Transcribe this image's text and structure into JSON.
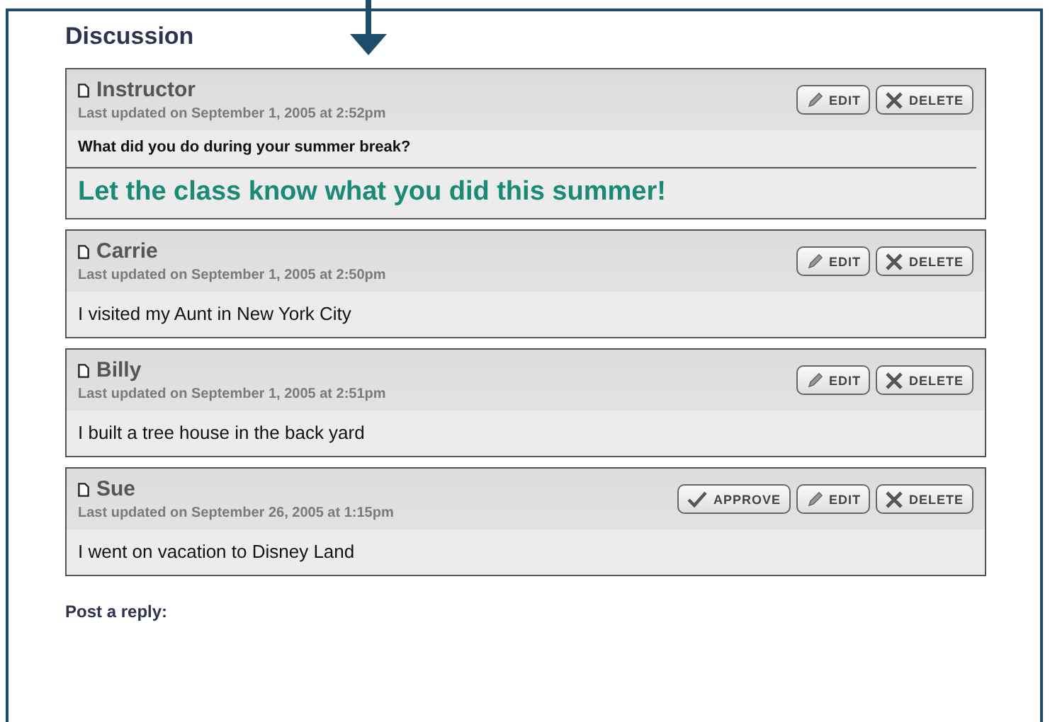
{
  "heading": "Discussion",
  "posts": [
    {
      "author": "Instructor",
      "updated": "Last updated on September 1, 2005 at 2:52pm",
      "actions": [
        {
          "kind": "edit",
          "label": "EDIT"
        },
        {
          "kind": "delete",
          "label": "DELETE"
        }
      ],
      "question": "What did you do during your summer break?",
      "prompt": "Let the class know what you did this summer!"
    },
    {
      "author": "Carrie",
      "updated": "Last updated on September 1, 2005 at 2:50pm",
      "actions": [
        {
          "kind": "edit",
          "label": "EDIT"
        },
        {
          "kind": "delete",
          "label": "DELETE"
        }
      ],
      "body": "I visited my Aunt in New York City"
    },
    {
      "author": "Billy",
      "updated": "Last updated on September 1, 2005 at 2:51pm",
      "actions": [
        {
          "kind": "edit",
          "label": "EDIT"
        },
        {
          "kind": "delete",
          "label": "DELETE"
        }
      ],
      "body": "I built a tree house in the back yard"
    },
    {
      "author": "Sue",
      "updated": "Last updated on September 26, 2005 at 1:15pm",
      "actions": [
        {
          "kind": "approve",
          "label": "APPROVE"
        },
        {
          "kind": "edit",
          "label": "EDIT"
        },
        {
          "kind": "delete",
          "label": "DELETE"
        }
      ],
      "body": "I went on vacation to Disney Land"
    }
  ],
  "reply_label": "Post a reply:"
}
